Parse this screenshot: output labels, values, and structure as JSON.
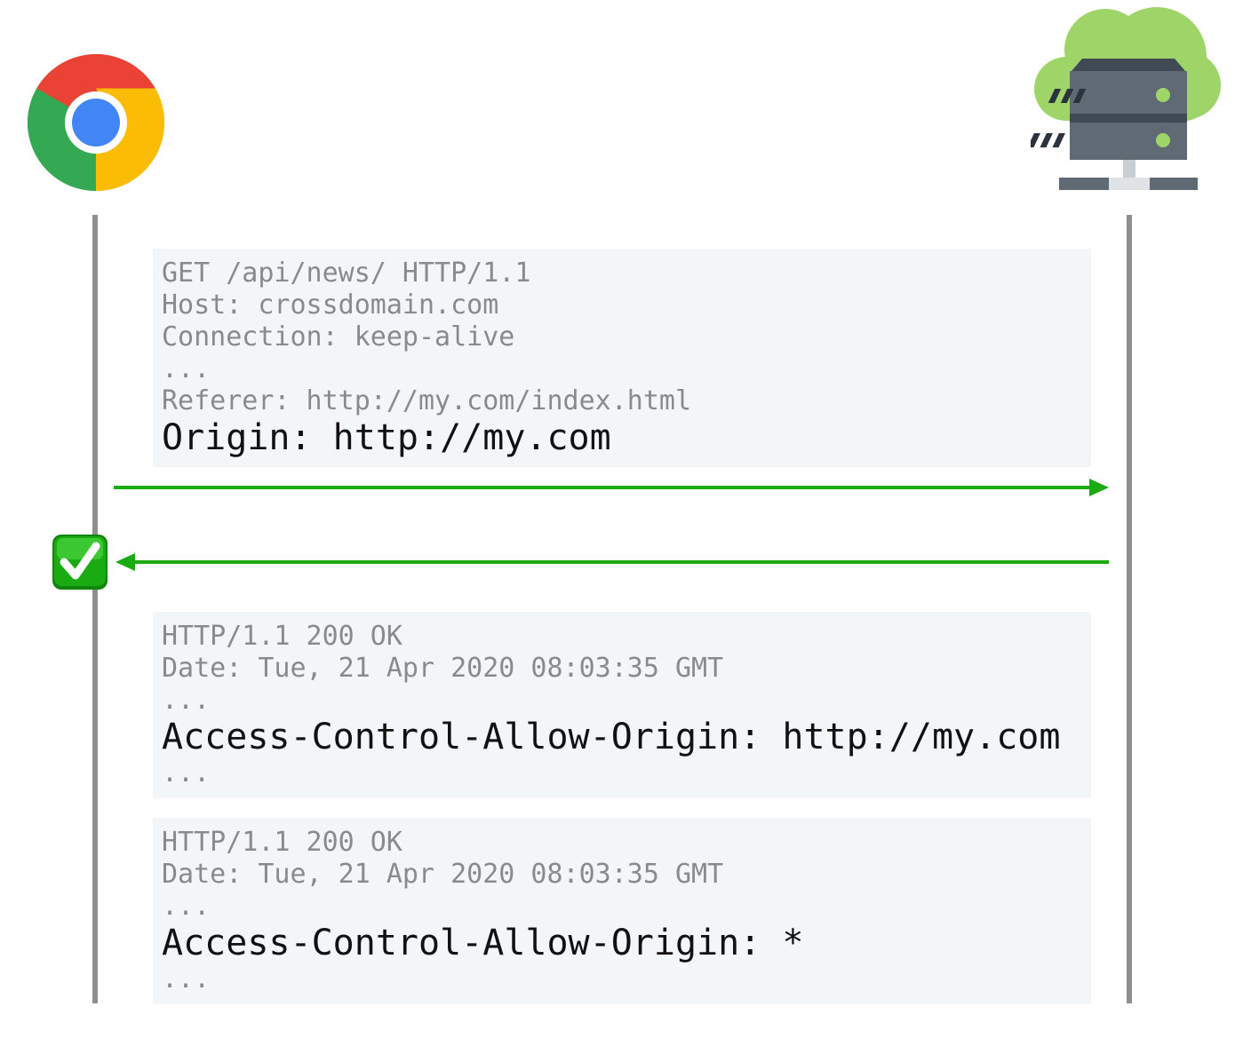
{
  "client": {
    "icon": "chrome-browser-icon"
  },
  "server": {
    "icon": "cloud-server-icon"
  },
  "request": {
    "lines": [
      {
        "text": "GET /api/news/ HTTP/1.1",
        "emphasis": false
      },
      {
        "text": "Host: crossdomain.com",
        "emphasis": false
      },
      {
        "text": "Connection: keep-alive",
        "emphasis": false
      },
      {
        "text": "...",
        "emphasis": false
      },
      {
        "text": "Referer: http://my.com/index.html",
        "emphasis": false
      },
      {
        "text": "Origin: http://my.com",
        "emphasis": true
      }
    ]
  },
  "response_check": {
    "icon": "check-mark-icon",
    "color": "#1aaa12"
  },
  "responses": [
    {
      "lines": [
        {
          "text": "HTTP/1.1 200 OK",
          "emphasis": false
        },
        {
          "text": "Date: Tue, 21 Apr 2020 08:03:35 GMT",
          "emphasis": false
        },
        {
          "text": "...",
          "emphasis": false
        },
        {
          "text": "Access-Control-Allow-Origin: http://my.com",
          "emphasis": true
        },
        {
          "text": "...",
          "emphasis": false
        }
      ]
    },
    {
      "lines": [
        {
          "text": "HTTP/1.1 200 OK",
          "emphasis": false
        },
        {
          "text": "Date: Tue, 21 Apr 2020 08:03:35 GMT",
          "emphasis": false
        },
        {
          "text": "...",
          "emphasis": false
        },
        {
          "text": "Access-Control-Allow-Origin: *",
          "emphasis": true
        },
        {
          "text": "...",
          "emphasis": false
        }
      ]
    }
  ],
  "colors": {
    "arrow": "#1aaa12",
    "lifeline": "#8e8e8e",
    "box": "#f3f6f9"
  }
}
